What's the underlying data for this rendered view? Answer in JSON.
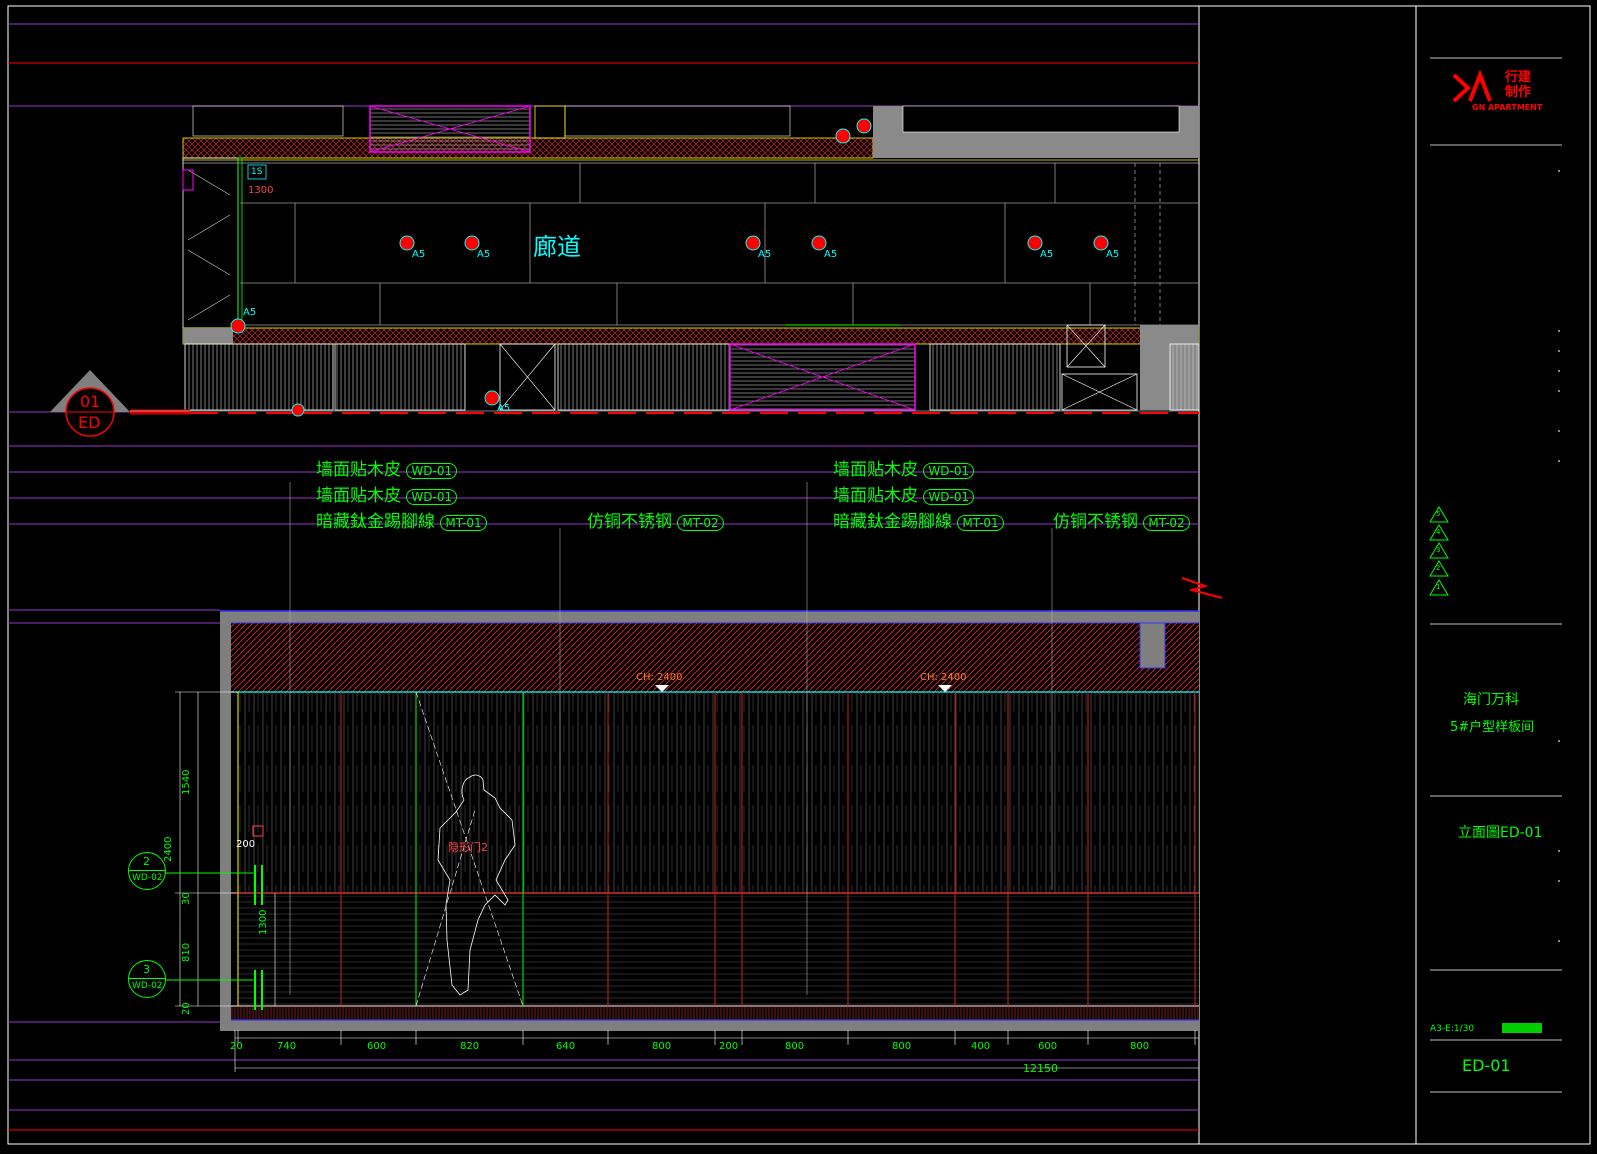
{
  "colors": {
    "background": "#000000",
    "green": "#00ff00",
    "cyan": "#00ffff",
    "magenta": "#ff00ff",
    "red": "#ff0000",
    "yellow": "#ffff00",
    "orange": "#ff7f27",
    "blue": "#3333ff",
    "gray": "#808080",
    "white": "#ffffff",
    "dark_red": "#8b0000",
    "purple": "#9933cc"
  },
  "plan": {
    "corridor_label": "廊道",
    "dim_1300": "1300",
    "tag_1s": "1S",
    "tag_a5": "A5",
    "section_marker": {
      "number": "01",
      "sheet": "ED"
    }
  },
  "elevation": {
    "callouts_left": [
      {
        "text": "墙面贴木皮",
        "code": "WD-01"
      },
      {
        "text": "墙面贴木皮",
        "code": "WD-01"
      },
      {
        "text": "暗藏鈦金踢腳線",
        "code": "MT-01"
      }
    ],
    "callout_mid_left": {
      "text": "仿铜不锈钢",
      "code": "MT-02"
    },
    "callouts_right": [
      {
        "text": "墙面贴木皮",
        "code": "WD-01"
      },
      {
        "text": "墙面贴木皮",
        "code": "WD-01"
      },
      {
        "text": "暗藏鈦金踢腳線",
        "code": "MT-01"
      }
    ],
    "callout_mid_right": {
      "text": "仿铜不锈钢",
      "code": "MT-02"
    },
    "ceiling_heights": [
      "CH: 2400",
      "CH: 2400"
    ],
    "door_label": "隐形门2",
    "dim_200": "200",
    "vertical_dims": [
      "1540",
      "2400",
      "30",
      "1300",
      "810",
      "20"
    ],
    "section_tags": [
      {
        "number": "2",
        "code": "WD-02"
      },
      {
        "number": "3",
        "code": "WD-02"
      }
    ],
    "horizontal_dims": [
      "20",
      "740",
      "600",
      "820",
      "640",
      "800",
      "200",
      "800",
      "800",
      "400",
      "600",
      "800"
    ],
    "total_width": "12150"
  },
  "title_block": {
    "logo_mark": "DA",
    "logo_cn_1": "行建",
    "logo_cn_2": "制作",
    "logo_en": "GN APARTMENT",
    "project_name": "海门万科",
    "project_sub": "5#户型样板间",
    "drawing_title": "立面圖ED-01",
    "sheet_number": "ED-01",
    "scale_text": "A3-E:1/30",
    "revisions": [
      "5",
      "4",
      "3",
      "2",
      "1"
    ]
  }
}
